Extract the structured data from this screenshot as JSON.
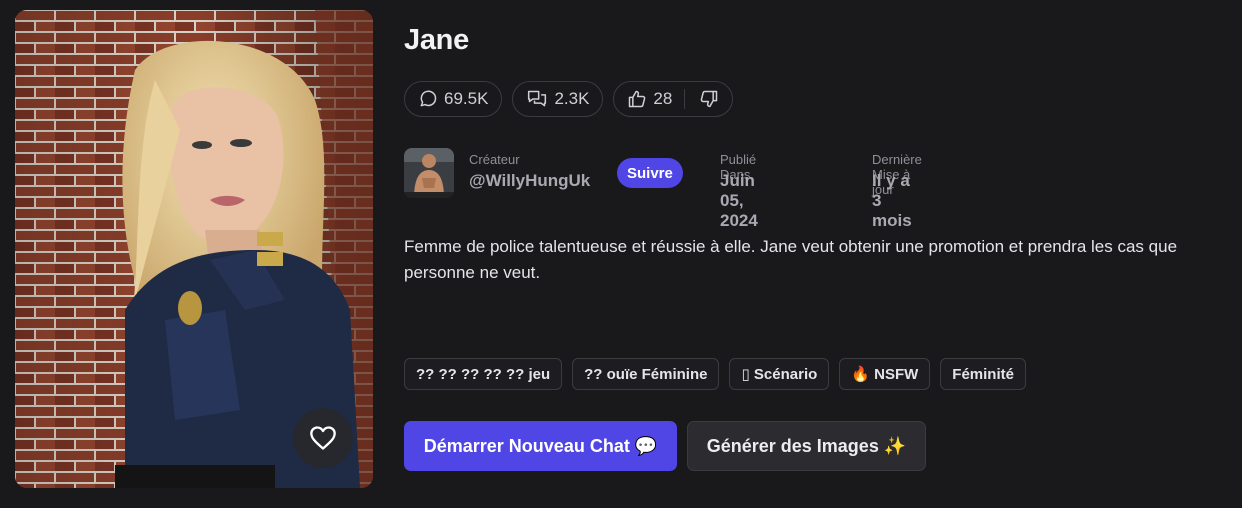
{
  "character": {
    "name": "Jane",
    "description": "Femme de police talentueuse et réussie à elle. Jane veut obtenir une promotion et prendra les cas que personne ne veut."
  },
  "stats": {
    "messages": "69.5K",
    "chats": "2.3K",
    "likes": "28"
  },
  "creator": {
    "label": "Créateur",
    "handle": "@WillyHungUk",
    "follow_label": "Suivre"
  },
  "published": {
    "label": "Publié Dans",
    "value": "Juin 05, 2024"
  },
  "updated": {
    "label": "Dernière Mise à jour",
    "value": "Il y a 3 mois"
  },
  "tags": [
    "?? ?? ?? ?? ?? jeu",
    "?? ouïe Féminine",
    "▯ Scénario",
    "🔥 NSFW",
    "Féminité"
  ],
  "actions": {
    "start_chat": "Démarrer Nouveau Chat 💬",
    "generate_images": "Générer des Images ✨"
  },
  "colors": {
    "accent": "#4f46e5",
    "background": "#19191c",
    "border": "#3b3b42"
  }
}
